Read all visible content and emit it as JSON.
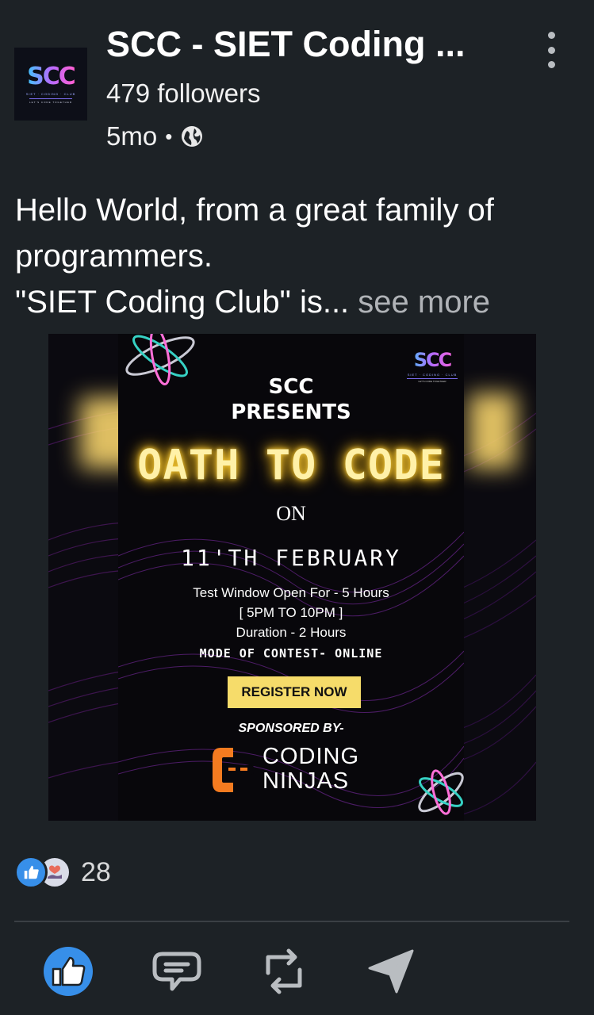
{
  "post": {
    "author": {
      "name": "SCC - SIET Coding ...",
      "followers": "479 followers",
      "time": "5mo",
      "separator": "•",
      "logo_mark": "SCC",
      "logo_sub": "SIET · CODING · CLUB",
      "logo_tagline": "LET'S CODE TOGETHER",
      "visibility_icon": "globe-icon",
      "menu_icon": "more-vertical-icon"
    },
    "text_lines": [
      "Hello World, from a great family of",
      "programmers.",
      "\"SIET Coding Club\" is..."
    ],
    "see_more": " see more",
    "poster": {
      "logo_mark": "SCC",
      "logo_sub": "SIET · CODING · CLUB",
      "logo_tagline": "LET'S CODE TOGETHER",
      "line1": "SCC",
      "line2": "PRESENTS",
      "title": "OATH TO CODE",
      "on": "ON",
      "date": "11'TH FEBRUARY",
      "window": "Test Window Open For - 5 Hours",
      "hours": "[ 5PM TO 10PM ]",
      "duration": "Duration - 2 Hours",
      "mode": "MODE OF CONTEST- ONLINE",
      "register": "REGISTER NOW",
      "sponsored": "SPONSORED BY-",
      "sponsor_line1": "CODING",
      "sponsor_line2": "NINJAS",
      "title_glow_color": "#f3c533",
      "button_color": "#f6dc6a"
    },
    "reactions": {
      "count": "28",
      "icons": [
        "like-reaction-icon",
        "love-reaction-icon"
      ]
    },
    "actions": [
      {
        "name": "like",
        "icon": "thumbs-up-icon",
        "active": true
      },
      {
        "name": "comment",
        "icon": "comment-icon"
      },
      {
        "name": "repost",
        "icon": "repost-icon"
      },
      {
        "name": "send",
        "icon": "send-icon"
      }
    ],
    "colors": {
      "background": "#1d2226",
      "accent": "#378fe9",
      "muted_text": "#b0b3b7"
    }
  }
}
